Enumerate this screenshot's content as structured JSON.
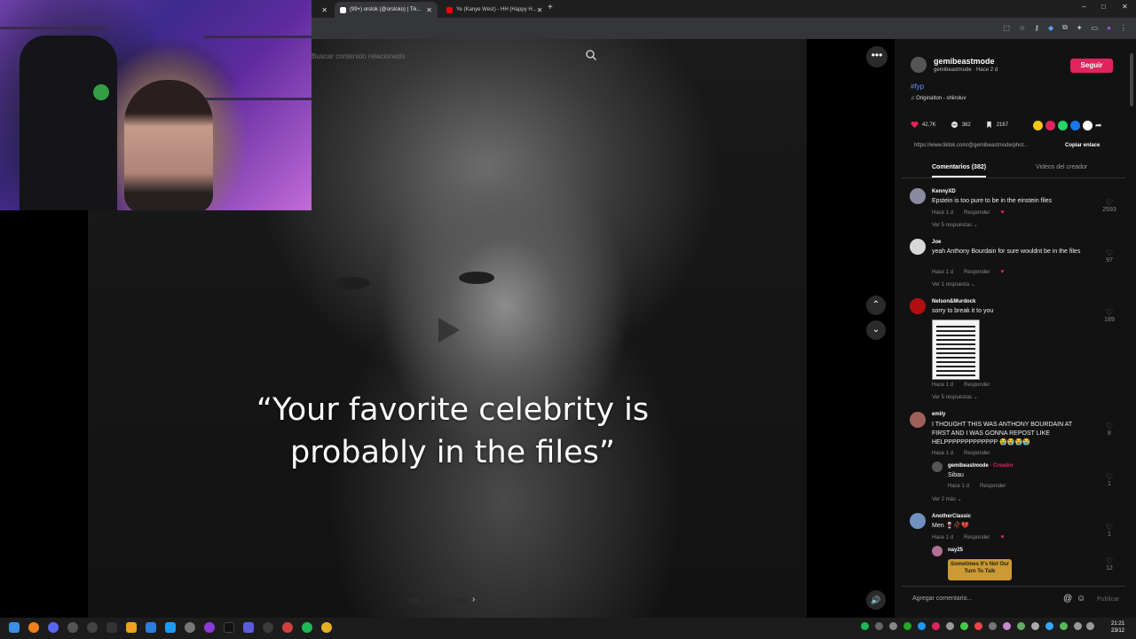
{
  "browser": {
    "tabs": [
      {
        "label": "(99+) orslok (@orsloko) | Tik...",
        "favicon_color": "#ffffff"
      },
      {
        "label": "Ye (Kanye West) - HH (Happy H...",
        "favicon_color": "#ff0000"
      }
    ],
    "new_tab": "+",
    "window_controls": [
      "–",
      "□",
      "✕"
    ]
  },
  "video": {
    "search_placeholder": "Buscar contenido relacionado",
    "caption_line1": "“Your favorite celebrity is",
    "caption_line2": "probably in the files”",
    "more_label": "•••",
    "prev_label": "⌃",
    "next_label": "⌄",
    "volume_label": "🔊",
    "next_image_label": "›"
  },
  "post": {
    "username": "gemibeastmode",
    "subline": "gemibeastmode · Hace 2 d",
    "follow_label": "Seguir",
    "hashtag": "#fyp",
    "music": "♫  Originalton - shiiroluv",
    "likes": "42.7K",
    "comments_count": "382",
    "saves": "2167",
    "link": "https://www.tiktok.com/@gemibeastmode/phot...",
    "copy_link_label": "Copiar enlace",
    "share_colors": [
      "#f5c518",
      "#e0245e",
      "#25d366",
      "#1877f2",
      "#ffffff"
    ]
  },
  "panel_tabs": {
    "comments": "Comentarios (382)",
    "creator_videos": "Videos del creador"
  },
  "comments": [
    {
      "name": "KennyXD",
      "text": "Epstein is too pure to be in the einstein files",
      "time": "Hace 1 d",
      "reply": "Responder",
      "likes": "2593",
      "replies": "Ver 5 respuestas ⌄",
      "avatar": "#8a8aa0"
    },
    {
      "name": "Joe",
      "text": "yeah Anthony Bourdain for sure wouldnt be in the files",
      "time": "Hace 1 d",
      "reply": "Responder",
      "likes": "97",
      "replies": "Ver 1 respuesta ⌄",
      "avatar": "#d8d8d8"
    },
    {
      "name": "Nelson&Murdock",
      "text": "sorry to break it to you",
      "time": "Hace 1 d",
      "reply": "Responder",
      "likes": "189",
      "replies": "Ver 5 respuestas ⌄",
      "avatar": "#b01010"
    },
    {
      "name": "emily",
      "text": "I THOUGHT THIS WAS ANTHONY BOURDAIN AT FIRST AND I WAS GONNA REPOST LIKE HELPPPPPPPPPPPPP 😭😭😭😭",
      "time": "Hace 1 d",
      "reply": "Responder",
      "likes": "8",
      "replies": "Ver 2 más ⌄",
      "avatar": "#a0605a"
    },
    {
      "name": "AnotherClassic",
      "text": "Men 🍷🥀💔",
      "time": "Hace 1 d",
      "reply": "Responder",
      "likes": "1",
      "avatar": "#7090c0"
    },
    {
      "name": "nay25",
      "likes": "12",
      "avatar": "#b07090"
    }
  ],
  "creator_reply": {
    "name": "gemibeastmode",
    "creator_tag": "· Creador",
    "text": "Sibau",
    "time": "Hace 1 d",
    "reply": "Responder",
    "likes": "1"
  },
  "sticker_text": "Sometimes It's Not Our Turn To Talk",
  "add_comment": {
    "placeholder": "Agregar comentario...",
    "mention": "@",
    "emoji": "☺",
    "publish": "Publicar"
  },
  "clock": {
    "time": "21:21",
    "date": "23/12"
  }
}
